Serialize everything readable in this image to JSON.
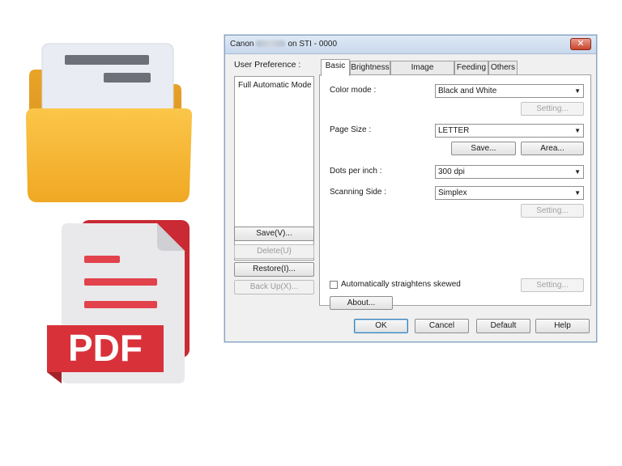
{
  "window": {
    "title_prefix": "Canon",
    "title_suffix": "on STI - 0000",
    "close_symbol": "✕"
  },
  "left_pane": {
    "user_preference_label": "User Preference :",
    "preferences": [
      "Full Automatic Mode"
    ],
    "buttons": {
      "save": "Save(V)...",
      "delete": "Delete(U)",
      "restore": "Restore(I)...",
      "backup": "Back Up(X)..."
    }
  },
  "tabs": [
    "Basic",
    "Brightness",
    "Image processing",
    "Feeding",
    "Others"
  ],
  "basic_tab": {
    "color_mode_label": "Color mode :",
    "color_mode_value": "Black and White",
    "color_setting_button": "Setting...",
    "page_size_label": "Page Size :",
    "page_size_value": "LETTER",
    "save_button": "Save...",
    "area_button": "Area...",
    "dpi_label": "Dots per inch :",
    "dpi_value": "300 dpi",
    "scanning_side_label": "Scanning Side :",
    "scanning_side_value": "Simplex",
    "side_setting_button": "Setting...",
    "straighten_label": "Automatically straightens skewed",
    "straighten_checked": false,
    "straighten_setting_button": "Setting...",
    "about_button": "About..."
  },
  "footer": {
    "ok": "OK",
    "cancel": "Cancel",
    "default": "Default",
    "help": "Help"
  },
  "icons": {
    "folder": "folder-icon",
    "pdf": "pdf-file-icon",
    "pdf_text": "PDF"
  },
  "colors": {
    "folder": "#f5b335",
    "pdf_red": "#d8313a",
    "accent": "#3c7fb1"
  }
}
